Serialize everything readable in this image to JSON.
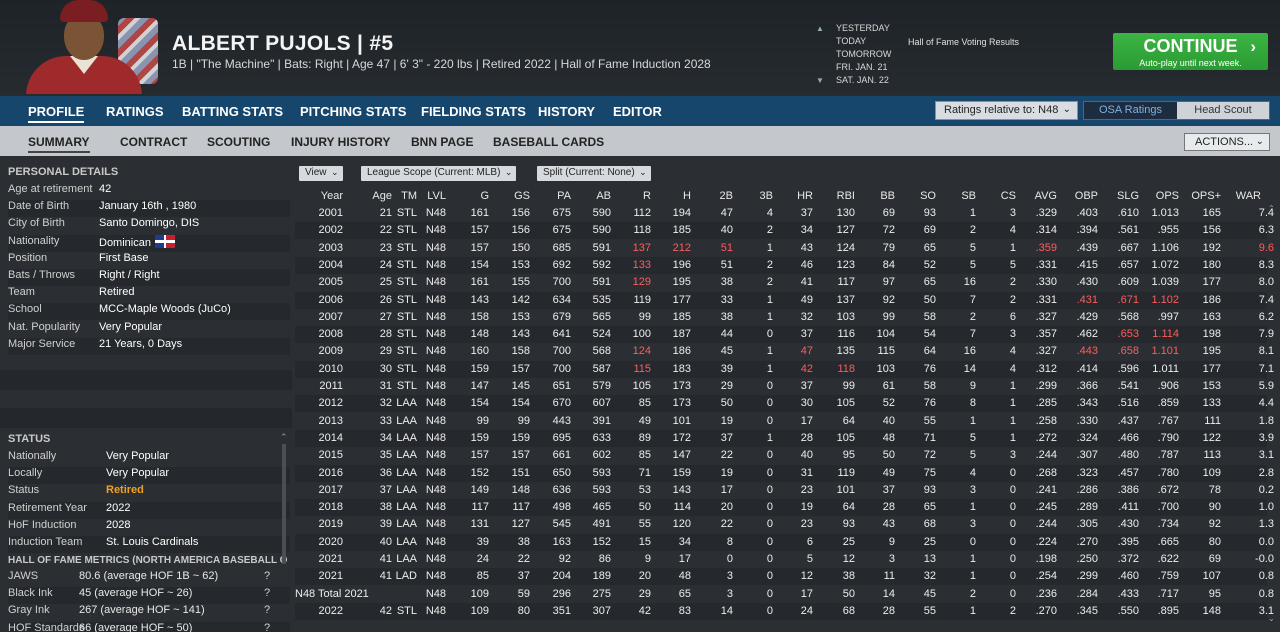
{
  "header": {
    "player_name": "ALBERT PUJOLS  |  #5",
    "player_bio": "1B | \"The Machine\" | Bats: Right  |  Age 47  |  6' 3\"  - 220 lbs  |  Retired 2022  |  Hall of Fame Induction 2028"
  },
  "calendar": {
    "days": [
      "YESTERDAY",
      "TODAY",
      "TOMORROW",
      "FRI. JAN. 21",
      "SAT. JAN. 22"
    ],
    "event": "Hall of Fame Voting Results"
  },
  "continue": {
    "label": "CONTINUE",
    "sub": "Auto-play until next week."
  },
  "nav1": {
    "items": [
      "PROFILE",
      "RATINGS",
      "BATTING STATS",
      "PITCHING STATS",
      "FIELDING STATS",
      "HISTORY",
      "EDITOR"
    ],
    "ratings_relative": "Ratings relative to: N48",
    "osa": "OSA Ratings",
    "head_scout": "Head Scout"
  },
  "nav2": {
    "items": [
      "SUMMARY",
      "CONTRACT",
      "SCOUTING",
      "INJURY HISTORY",
      "BNN PAGE",
      "BASEBALL CARDS"
    ],
    "actions": "ACTIONS..."
  },
  "personal": {
    "title": "PERSONAL DETAILS",
    "rows": [
      {
        "k": "Age at retirement",
        "v": "42"
      },
      {
        "k": "Date of Birth",
        "v": "January 16th , 1980"
      },
      {
        "k": "City of Birth",
        "v": "Santo Domingo, DIS"
      },
      {
        "k": "Nationality",
        "v": "Dominican"
      },
      {
        "k": "Position",
        "v": "First Base"
      },
      {
        "k": "Bats / Throws",
        "v": "Right / Right"
      },
      {
        "k": "Team",
        "v": "Retired"
      },
      {
        "k": "School",
        "v": "MCC-Maple Woods (JuCo)"
      },
      {
        "k": "Nat. Popularity",
        "v": "Very Popular"
      },
      {
        "k": "Major Service",
        "v": "21 Years, 0 Days"
      }
    ]
  },
  "status": {
    "title": "STATUS",
    "rows": [
      {
        "k": "Nationally",
        "v": "Very Popular"
      },
      {
        "k": "Locally",
        "v": "Very Popular"
      },
      {
        "k": "Status",
        "v": "Retired"
      },
      {
        "k": "Retirement Year",
        "v": "2022"
      },
      {
        "k": "HoF Induction",
        "v": "2028"
      },
      {
        "k": "Induction Team",
        "v": "St. Louis Cardinals"
      }
    ],
    "status_color": "#f0a020"
  },
  "hof": {
    "title": "HALL OF FAME METRICS (NORTH AMERICA BASEBALL O",
    "rows": [
      {
        "k": "JAWS",
        "v": "80.6 (average HOF 1B ~ 62)",
        "q": "?"
      },
      {
        "k": "Black Ink",
        "v": "45 (average HOF ~ 26)",
        "q": "?"
      },
      {
        "k": "Gray Ink",
        "v": "267 (average HOF ~ 141)",
        "q": "?"
      },
      {
        "k": "HOF Standards",
        "v": "66 (average HOF ~ 50)",
        "q": "?"
      }
    ]
  },
  "filters": {
    "view": "View",
    "scope": "League Scope (Current: MLB)",
    "split": "Split  (Current: None)"
  },
  "table": {
    "headers": [
      "Year",
      "Age",
      "TM",
      "LVL",
      "G",
      "GS",
      "PA",
      "AB",
      "R",
      "H",
      "2B",
      "3B",
      "HR",
      "RBI",
      "BB",
      "SO",
      "SB",
      "CS",
      "AVG",
      "OBP",
      "SLG",
      "OPS",
      "OPS+",
      "WAR"
    ],
    "rows": [
      [
        "2001",
        "21",
        "STL",
        "N48",
        "161",
        "156",
        "675",
        "590",
        "112",
        "194",
        "47",
        "4",
        "37",
        "130",
        "69",
        "93",
        "1",
        "3",
        ".329",
        ".403",
        ".610",
        "1.013",
        "165",
        "7.4"
      ],
      [
        "2002",
        "22",
        "STL",
        "N48",
        "157",
        "156",
        "675",
        "590",
        "118",
        "185",
        "40",
        "2",
        "34",
        "127",
        "72",
        "69",
        "2",
        "4",
        ".314",
        ".394",
        ".561",
        ".955",
        "156",
        "6.3"
      ],
      [
        "2003",
        "23",
        "STL",
        "N48",
        "157",
        "150",
        "685",
        "591",
        "137",
        "212",
        "51",
        "1",
        "43",
        "124",
        "79",
        "65",
        "5",
        "1",
        ".359",
        ".439",
        ".667",
        "1.106",
        "192",
        "9.6"
      ],
      [
        "2004",
        "24",
        "STL",
        "N48",
        "154",
        "153",
        "692",
        "592",
        "133",
        "196",
        "51",
        "2",
        "46",
        "123",
        "84",
        "52",
        "5",
        "5",
        ".331",
        ".415",
        ".657",
        "1.072",
        "180",
        "8.3"
      ],
      [
        "2005",
        "25",
        "STL",
        "N48",
        "161",
        "155",
        "700",
        "591",
        "129",
        "195",
        "38",
        "2",
        "41",
        "117",
        "97",
        "65",
        "16",
        "2",
        ".330",
        ".430",
        ".609",
        "1.039",
        "177",
        "8.0"
      ],
      [
        "2006",
        "26",
        "STL",
        "N48",
        "143",
        "142",
        "634",
        "535",
        "119",
        "177",
        "33",
        "1",
        "49",
        "137",
        "92",
        "50",
        "7",
        "2",
        ".331",
        ".431",
        ".671",
        "1.102",
        "186",
        "7.4"
      ],
      [
        "2007",
        "27",
        "STL",
        "N48",
        "158",
        "153",
        "679",
        "565",
        "99",
        "185",
        "38",
        "1",
        "32",
        "103",
        "99",
        "58",
        "2",
        "6",
        ".327",
        ".429",
        ".568",
        ".997",
        "163",
        "6.2"
      ],
      [
        "2008",
        "28",
        "STL",
        "N48",
        "148",
        "143",
        "641",
        "524",
        "100",
        "187",
        "44",
        "0",
        "37",
        "116",
        "104",
        "54",
        "7",
        "3",
        ".357",
        ".462",
        ".653",
        "1.114",
        "198",
        "7.9"
      ],
      [
        "2009",
        "29",
        "STL",
        "N48",
        "160",
        "158",
        "700",
        "568",
        "124",
        "186",
        "45",
        "1",
        "47",
        "135",
        "115",
        "64",
        "16",
        "4",
        ".327",
        ".443",
        ".658",
        "1.101",
        "195",
        "8.1"
      ],
      [
        "2010",
        "30",
        "STL",
        "N48",
        "159",
        "157",
        "700",
        "587",
        "115",
        "183",
        "39",
        "1",
        "42",
        "118",
        "103",
        "76",
        "14",
        "4",
        ".312",
        ".414",
        ".596",
        "1.011",
        "177",
        "7.1"
      ],
      [
        "2011",
        "31",
        "STL",
        "N48",
        "147",
        "145",
        "651",
        "579",
        "105",
        "173",
        "29",
        "0",
        "37",
        "99",
        "61",
        "58",
        "9",
        "1",
        ".299",
        ".366",
        ".541",
        ".906",
        "153",
        "5.9"
      ],
      [
        "2012",
        "32",
        "LAA",
        "N48",
        "154",
        "154",
        "670",
        "607",
        "85",
        "173",
        "50",
        "0",
        "30",
        "105",
        "52",
        "76",
        "8",
        "1",
        ".285",
        ".343",
        ".516",
        ".859",
        "133",
        "4.4"
      ],
      [
        "2013",
        "33",
        "LAA",
        "N48",
        "99",
        "99",
        "443",
        "391",
        "49",
        "101",
        "19",
        "0",
        "17",
        "64",
        "40",
        "55",
        "1",
        "1",
        ".258",
        ".330",
        ".437",
        ".767",
        "111",
        "1.8"
      ],
      [
        "2014",
        "34",
        "LAA",
        "N48",
        "159",
        "159",
        "695",
        "633",
        "89",
        "172",
        "37",
        "1",
        "28",
        "105",
        "48",
        "71",
        "5",
        "1",
        ".272",
        ".324",
        ".466",
        ".790",
        "122",
        "3.9"
      ],
      [
        "2015",
        "35",
        "LAA",
        "N48",
        "157",
        "157",
        "661",
        "602",
        "85",
        "147",
        "22",
        "0",
        "40",
        "95",
        "50",
        "72",
        "5",
        "3",
        ".244",
        ".307",
        ".480",
        ".787",
        "113",
        "3.1"
      ],
      [
        "2016",
        "36",
        "LAA",
        "N48",
        "152",
        "151",
        "650",
        "593",
        "71",
        "159",
        "19",
        "0",
        "31",
        "119",
        "49",
        "75",
        "4",
        "0",
        ".268",
        ".323",
        ".457",
        ".780",
        "109",
        "2.8"
      ],
      [
        "2017",
        "37",
        "LAA",
        "N48",
        "149",
        "148",
        "636",
        "593",
        "53",
        "143",
        "17",
        "0",
        "23",
        "101",
        "37",
        "93",
        "3",
        "0",
        ".241",
        ".286",
        ".386",
        ".672",
        "78",
        "0.2"
      ],
      [
        "2018",
        "38",
        "LAA",
        "N48",
        "117",
        "117",
        "498",
        "465",
        "50",
        "114",
        "20",
        "0",
        "19",
        "64",
        "28",
        "65",
        "1",
        "0",
        ".245",
        ".289",
        ".411",
        ".700",
        "90",
        "1.0"
      ],
      [
        "2019",
        "39",
        "LAA",
        "N48",
        "131",
        "127",
        "545",
        "491",
        "55",
        "120",
        "22",
        "0",
        "23",
        "93",
        "43",
        "68",
        "3",
        "0",
        ".244",
        ".305",
        ".430",
        ".734",
        "92",
        "1.3"
      ],
      [
        "2020",
        "40",
        "LAA",
        "N48",
        "39",
        "38",
        "163",
        "152",
        "15",
        "34",
        "8",
        "0",
        "6",
        "25",
        "9",
        "25",
        "0",
        "0",
        ".224",
        ".270",
        ".395",
        ".665",
        "80",
        "0.0"
      ],
      [
        "2021",
        "41",
        "LAA",
        "N48",
        "24",
        "22",
        "92",
        "86",
        "9",
        "17",
        "0",
        "0",
        "5",
        "12",
        "3",
        "13",
        "1",
        "0",
        ".198",
        ".250",
        ".372",
        ".622",
        "69",
        "-0.0"
      ],
      [
        "2021",
        "41",
        "LAD",
        "N48",
        "85",
        "37",
        "204",
        "189",
        "20",
        "48",
        "3",
        "0",
        "12",
        "38",
        "11",
        "32",
        "1",
        "0",
        ".254",
        ".299",
        ".460",
        ".759",
        "107",
        "0.8"
      ],
      [
        "N48 Total 2021",
        "",
        "",
        "N48",
        "109",
        "59",
        "296",
        "275",
        "29",
        "65",
        "3",
        "0",
        "17",
        "50",
        "14",
        "45",
        "2",
        "0",
        ".236",
        ".284",
        ".433",
        ".717",
        "95",
        "0.8"
      ],
      [
        "2022",
        "42",
        "STL",
        "N48",
        "109",
        "80",
        "351",
        "307",
        "42",
        "83",
        "14",
        "0",
        "24",
        "68",
        "28",
        "55",
        "1",
        "2",
        ".270",
        ".345",
        ".550",
        ".895",
        "148",
        "3.1"
      ]
    ],
    "highlight_color": "#ff5c5c",
    "highlights": {
      "2": [
        8,
        9,
        10,
        18,
        23
      ],
      "3": [
        8
      ],
      "4": [
        8
      ],
      "5": [
        19,
        20,
        21
      ],
      "7": [
        20,
        21
      ],
      "8": [
        8,
        12,
        19,
        20,
        21
      ],
      "9": [
        8,
        12,
        13
      ]
    }
  }
}
